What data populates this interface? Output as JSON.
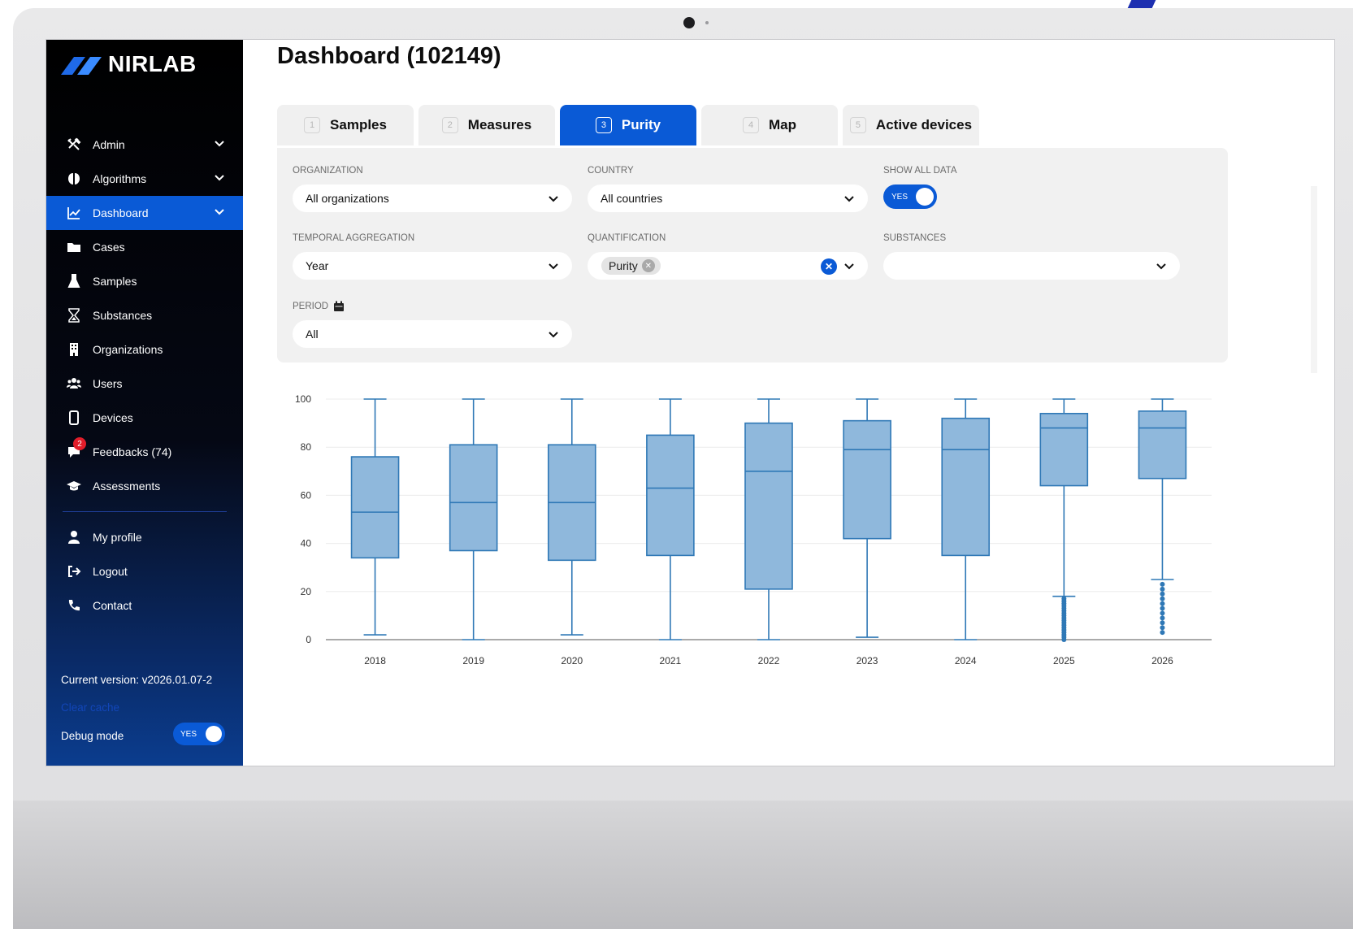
{
  "app": {
    "brand": "NIRLAB",
    "page_title": "Dashboard (102149)"
  },
  "sidebar": {
    "items": [
      {
        "label": "Admin",
        "icon": "tools-icon",
        "chevron": true
      },
      {
        "label": "Algorithms",
        "icon": "brain-icon",
        "chevron": true
      },
      {
        "label": "Dashboard",
        "icon": "chart-line-icon",
        "chevron": true,
        "active": true
      },
      {
        "label": "Cases",
        "icon": "folder-icon"
      },
      {
        "label": "Samples",
        "icon": "flask-icon"
      },
      {
        "label": "Substances",
        "icon": "hourglass-icon"
      },
      {
        "label": "Organizations",
        "icon": "building-icon"
      },
      {
        "label": "Users",
        "icon": "users-icon"
      },
      {
        "label": "Devices",
        "icon": "device-icon"
      },
      {
        "label": "Feedbacks (74)",
        "icon": "comment-icon",
        "badge": "2"
      },
      {
        "label": "Assessments",
        "icon": "graduation-cap-icon"
      }
    ],
    "bottom_items": [
      {
        "label": "My profile",
        "icon": "user-icon"
      },
      {
        "label": "Logout",
        "icon": "logout-icon"
      },
      {
        "label": "Contact",
        "icon": "phone-icon"
      }
    ],
    "version": "Current version: v2026.01.07-2",
    "clear_cache": "Clear cache",
    "debug_label": "Debug mode",
    "debug_toggle": "YES"
  },
  "tabs": [
    {
      "num": "1",
      "label": "Samples"
    },
    {
      "num": "2",
      "label": "Measures"
    },
    {
      "num": "3",
      "label": "Purity",
      "active": true
    },
    {
      "num": "4",
      "label": "Map"
    },
    {
      "num": "5",
      "label": "Active devices"
    }
  ],
  "filters": {
    "organization": {
      "label": "ORGANIZATION",
      "value": "All organizations"
    },
    "country": {
      "label": "COUNTRY",
      "value": "All countries"
    },
    "show_all_data": {
      "label": "SHOW ALL DATA",
      "value": "YES"
    },
    "temporal_aggregation": {
      "label": "TEMPORAL AGGREGATION",
      "value": "Year"
    },
    "quantification": {
      "label": "QUANTIFICATION",
      "chip": "Purity"
    },
    "substances": {
      "label": "SUBSTANCES",
      "value": ""
    },
    "period": {
      "label": "PERIOD",
      "value": "All"
    }
  },
  "colors": {
    "accent": "#0a5ad6",
    "box_fill": "#8fb8dc",
    "box_stroke": "#2f78b6"
  },
  "chart_data": {
    "type": "box",
    "categories": [
      "2018",
      "2019",
      "2020",
      "2021",
      "2022",
      "2023",
      "2024",
      "2025",
      "2026"
    ],
    "boxes": [
      {
        "min": 2,
        "q1": 34,
        "median": 53,
        "q3": 76,
        "max": 100
      },
      {
        "min": 0,
        "q1": 37,
        "median": 57,
        "q3": 81,
        "max": 100
      },
      {
        "min": 2,
        "q1": 33,
        "median": 57,
        "q3": 81,
        "max": 100
      },
      {
        "min": 0,
        "q1": 35,
        "median": 63,
        "q3": 85,
        "max": 100
      },
      {
        "min": 0,
        "q1": 21,
        "median": 70,
        "q3": 90,
        "max": 100
      },
      {
        "min": 1,
        "q1": 42,
        "median": 79,
        "q3": 91,
        "max": 100
      },
      {
        "min": 0,
        "q1": 35,
        "median": 79,
        "q3": 92,
        "max": 100
      },
      {
        "min": 18,
        "q1": 64,
        "median": 88,
        "q3": 94,
        "max": 100,
        "outliers": [
          0,
          1,
          2,
          3,
          4,
          5,
          6,
          7,
          8,
          9,
          10,
          11,
          12,
          13,
          14,
          15,
          16,
          17
        ]
      },
      {
        "min": 25,
        "q1": 67,
        "median": 88,
        "q3": 95,
        "max": 100,
        "outliers": [
          3,
          5,
          7,
          9,
          11,
          13,
          15,
          17,
          19,
          21,
          23
        ]
      }
    ],
    "yticks": [
      0,
      20,
      40,
      60,
      80,
      100
    ],
    "ylim": [
      0,
      100
    ],
    "grid": true,
    "xlabel": "",
    "ylabel": ""
  }
}
